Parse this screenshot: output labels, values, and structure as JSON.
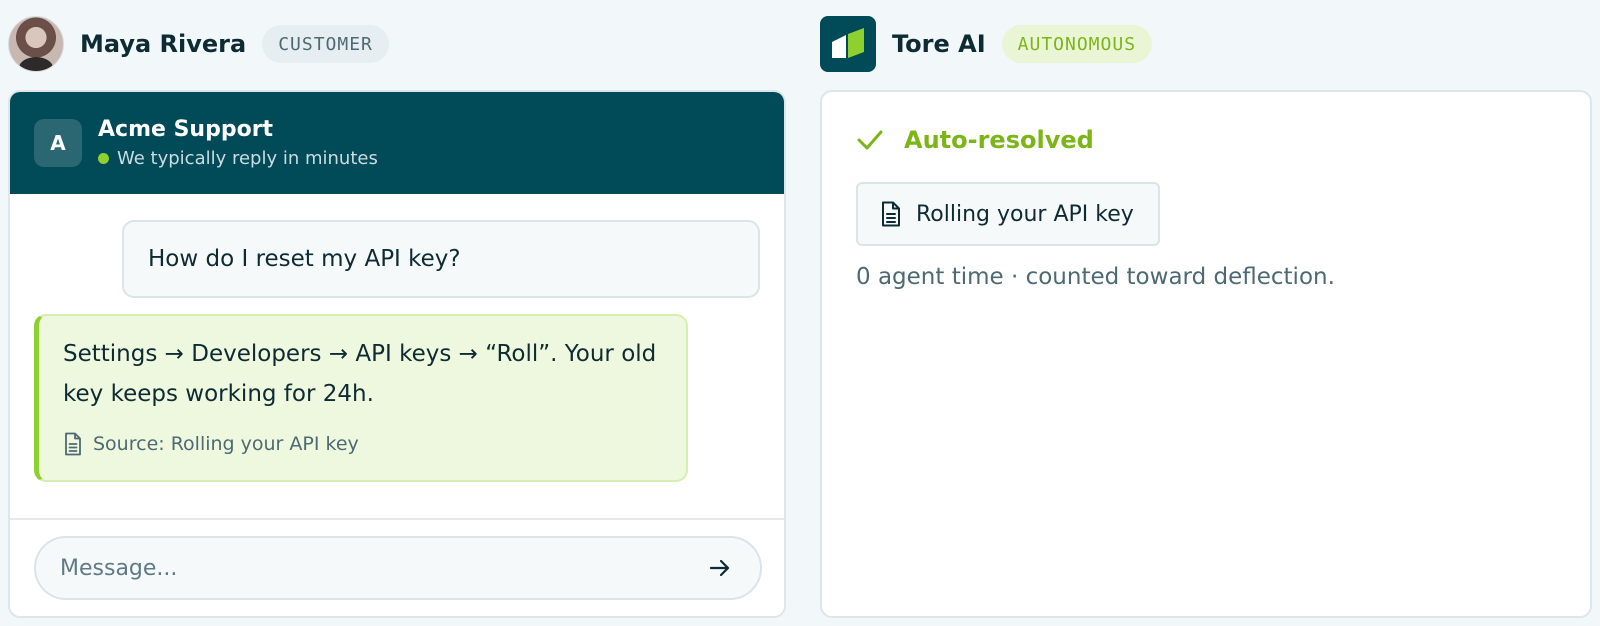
{
  "customer": {
    "name": "Maya Rivera",
    "role_badge": "CUSTOMER"
  },
  "chat": {
    "brand_initial": "A",
    "brand_name": "Acme Support",
    "status_text": "We typically reply in minutes",
    "user_message": "How do I reset my API key?",
    "bot_message": "Settings → Developers → API keys → “Roll”. Your old key keeps working for 24h.",
    "bot_source": "Source: Rolling your API key",
    "composer_placeholder": "Message..."
  },
  "ai": {
    "name": "Tore AI",
    "mode_badge": "AUTONOMOUS",
    "resolution_status": "Auto-resolved",
    "article_title": "Rolling your API key",
    "deflection_note": "0 agent time · counted toward deflection."
  },
  "colors": {
    "brand_dark": "#014a57",
    "accent_green": "#8ed12e",
    "resolved_green": "#7cb518"
  },
  "icons": {
    "resolution": "check-icon",
    "article": "document-icon",
    "send": "arrow-right-icon"
  }
}
